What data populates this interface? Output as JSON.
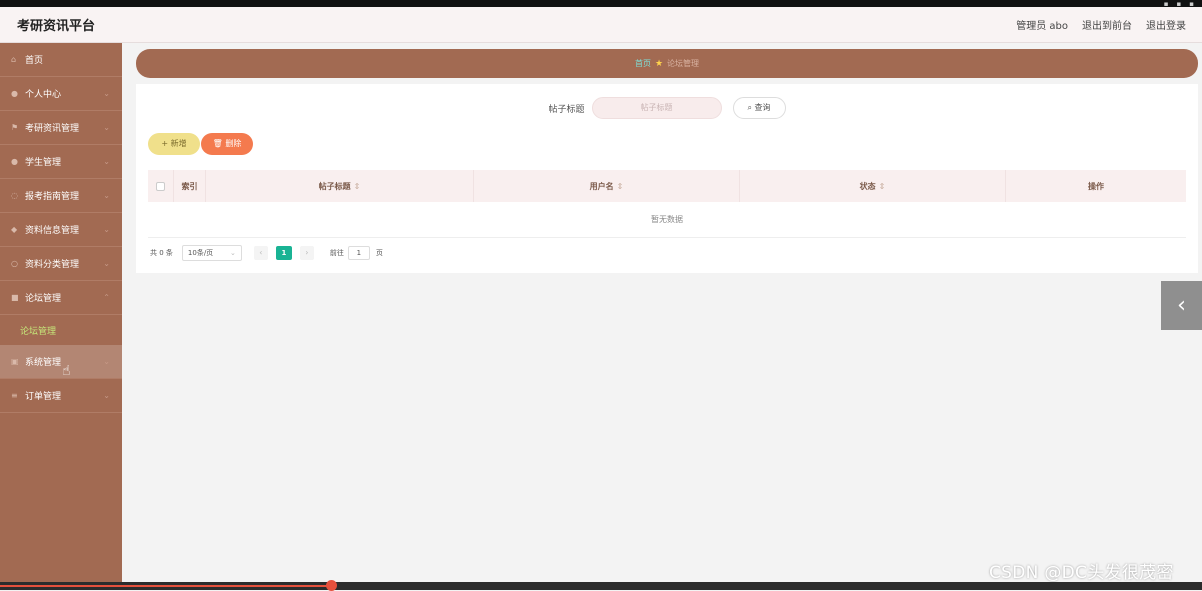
{
  "header": {
    "title": "考研资讯平台",
    "user": "管理员 abo",
    "back_to_front": "退出到前台",
    "logout": "退出登录"
  },
  "sidebar": {
    "items": [
      {
        "label": "首页",
        "icon": "home-icon"
      },
      {
        "label": "个人中心",
        "icon": "user-icon"
      },
      {
        "label": "考研资讯管理",
        "icon": "flag-icon"
      },
      {
        "label": "学生管理",
        "icon": "student-icon"
      },
      {
        "label": "报考指南管理",
        "icon": "guide-icon"
      },
      {
        "label": "资料信息管理",
        "icon": "info-icon"
      },
      {
        "label": "资料分类管理",
        "icon": "category-icon"
      },
      {
        "label": "论坛管理",
        "icon": "forum-icon"
      },
      {
        "label": "系统管理",
        "icon": "system-icon"
      },
      {
        "label": "订单管理",
        "icon": "order-icon"
      }
    ],
    "sub_item": "论坛管理"
  },
  "breadcrumb": {
    "home": "首页",
    "current": "论坛管理"
  },
  "search": {
    "label": "帖子标题",
    "placeholder": "帖子标题",
    "button": "查询"
  },
  "actions": {
    "add": "+ 新增",
    "delete": "删除"
  },
  "table": {
    "columns": [
      "索引",
      "帖子标题",
      "用户名",
      "状态",
      "操作"
    ],
    "empty_text": "暂无数据"
  },
  "pager": {
    "total": "共 0 条",
    "page_size": "10条/页",
    "current_page": "1",
    "goto_label": "前往",
    "goto_value": "1",
    "page_unit": "页"
  },
  "watermark": "CSDN @DC头发很茂密",
  "colors": {
    "sidebar": "#a26a52",
    "accent": "#19b394",
    "add_button": "#f0e08b",
    "delete_button": "#f47a4e"
  },
  "video_progress": 0.275
}
